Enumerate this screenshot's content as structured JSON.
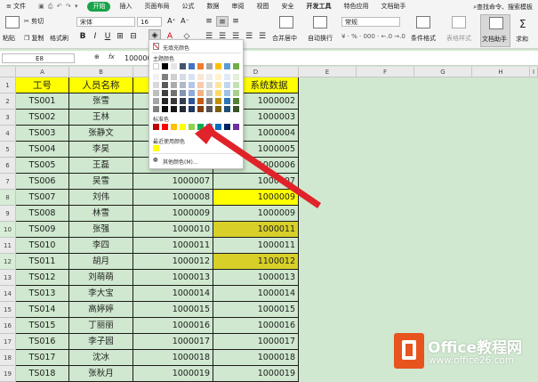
{
  "menu": {
    "file": "≡ 文件",
    "tabs": [
      "开始",
      "插入",
      "页面布局",
      "公式",
      "数据",
      "审阅",
      "视图",
      "安全",
      "开发工具",
      "特色应用",
      "文档助手"
    ],
    "active_tab": "开始",
    "search": "查找命令、搜索模板"
  },
  "ribbon": {
    "paste": "粘贴",
    "cut": "剪切",
    "copy": "复制",
    "format_painter": "格式刷",
    "font_name": "宋体",
    "font_size": "16",
    "number_format": "常规",
    "merge_center": "合并居中",
    "wrap_text": "自动换行",
    "conditional_format": "条件格式",
    "table_style": "表格样式",
    "doc_helper": "文档助手",
    "sum": "求和"
  },
  "formula_bar": {
    "name_box": "E8",
    "fx": "fx",
    "value": "100000"
  },
  "columns": [
    "A",
    "B",
    "C",
    "D",
    "E",
    "F",
    "G",
    "H",
    "I"
  ],
  "sheet": {
    "header": [
      "工号",
      "人员名称",
      "",
      "系统数据"
    ],
    "rows": [
      {
        "n": "2",
        "a": "TS001",
        "b": "张雪",
        "c": "",
        "d": "1000002",
        "fill": ""
      },
      {
        "n": "3",
        "a": "TS002",
        "b": "王林",
        "c": "",
        "d": "1000003",
        "fill": ""
      },
      {
        "n": "4",
        "a": "TS003",
        "b": "张静文",
        "c": "",
        "d": "1000004",
        "fill": ""
      },
      {
        "n": "5",
        "a": "TS004",
        "b": "李昊",
        "c": "",
        "d": "1000005",
        "fill": ""
      },
      {
        "n": "6",
        "a": "TS005",
        "b": "王磊",
        "c": "",
        "d": "1000006",
        "fill": ""
      },
      {
        "n": "7",
        "a": "TS006",
        "b": "吴雪",
        "c": "1000007",
        "d": "1000007",
        "fill": ""
      },
      {
        "n": "8",
        "a": "TS007",
        "b": "刘伟",
        "c": "1000008",
        "d": "1000009",
        "fill": "yel"
      },
      {
        "n": "9",
        "a": "TS008",
        "b": "林雪",
        "c": "1000009",
        "d": "1000009",
        "fill": ""
      },
      {
        "n": "10",
        "a": "TS009",
        "b": "张强",
        "c": "1000010",
        "d": "1000011",
        "fill": "olv"
      },
      {
        "n": "11",
        "a": "TS010",
        "b": "李四",
        "c": "1000011",
        "d": "1000011",
        "fill": ""
      },
      {
        "n": "12",
        "a": "TS011",
        "b": "胡月",
        "c": "1000012",
        "d": "1100012",
        "fill": "olv"
      },
      {
        "n": "13",
        "a": "TS012",
        "b": "刘萌萌",
        "c": "1000013",
        "d": "1000013",
        "fill": ""
      },
      {
        "n": "14",
        "a": "TS013",
        "b": "李大宝",
        "c": "1000014",
        "d": "1000014",
        "fill": ""
      },
      {
        "n": "15",
        "a": "TS014",
        "b": "高婷婷",
        "c": "1000015",
        "d": "1000015",
        "fill": ""
      },
      {
        "n": "16",
        "a": "TS015",
        "b": "丁丽丽",
        "c": "1000016",
        "d": "1000016",
        "fill": ""
      },
      {
        "n": "17",
        "a": "TS016",
        "b": "李子园",
        "c": "1000017",
        "d": "1000017",
        "fill": ""
      },
      {
        "n": "18",
        "a": "TS017",
        "b": "沈冰",
        "c": "1000018",
        "d": "1000018",
        "fill": ""
      },
      {
        "n": "19",
        "a": "TS018",
        "b": "张秋月",
        "c": "1000019",
        "d": "1000019",
        "fill": ""
      }
    ]
  },
  "color_popup": {
    "no_fill": "无填充颜色",
    "theme_colors": "主题颜色",
    "standard_colors": "标准色",
    "recent_colors": "最近使用颜色",
    "more_colors": "其他颜色(M)...",
    "theme_top": [
      "#ffffff",
      "#000000",
      "#e7e6e6",
      "#44546a",
      "#4472c4",
      "#ed7d31",
      "#a5a5a5",
      "#ffc000",
      "#5b9bd5",
      "#70ad47"
    ],
    "theme_shades": [
      [
        "#f2f2f2",
        "#7f7f7f",
        "#d0cece",
        "#d6dce4",
        "#d9e2f3",
        "#fbe5d5",
        "#ededed",
        "#fff2cc",
        "#deebf6",
        "#e2efd9"
      ],
      [
        "#d8d8d8",
        "#595959",
        "#aeaaaa",
        "#adb9ca",
        "#b4c6e7",
        "#f7cbac",
        "#dbdbdb",
        "#fee599",
        "#bdd7ee",
        "#c5e0b3"
      ],
      [
        "#bfbfbf",
        "#3f3f3f",
        "#757070",
        "#8496b0",
        "#8eaadb",
        "#f4b183",
        "#c9c9c9",
        "#ffd965",
        "#9cc3e5",
        "#a8d08d"
      ],
      [
        "#a5a5a5",
        "#262626",
        "#3a3838",
        "#323f4f",
        "#2f5496",
        "#c55a11",
        "#7b7b7b",
        "#bf9000",
        "#2e75b5",
        "#538135"
      ],
      [
        "#7f7f7f",
        "#0c0c0c",
        "#171616",
        "#222a35",
        "#1f3864",
        "#833c0b",
        "#525252",
        "#7f6000",
        "#1e4e79",
        "#375623"
      ]
    ],
    "standard": [
      "#c00000",
      "#ff0000",
      "#ffc000",
      "#ffff00",
      "#92d050",
      "#00b050",
      "#00b0f0",
      "#0070c0",
      "#002060",
      "#7030a0"
    ],
    "recent": [
      "#ffff00"
    ]
  },
  "watermark": {
    "brand": "Office教程网",
    "url": "www.office26.com",
    "logo_color": "#e8541e",
    "text_color": "#ffffff"
  },
  "arrow_color": "#e0232a"
}
